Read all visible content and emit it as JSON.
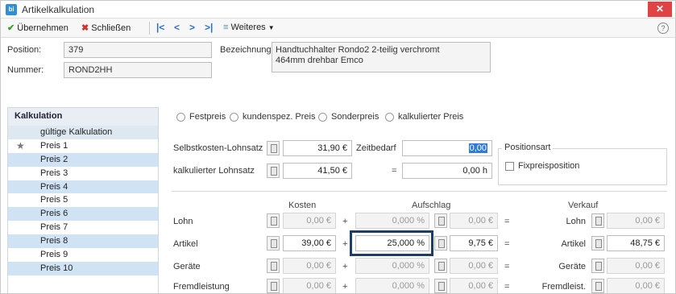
{
  "window": {
    "title": "Artikelkalkulation",
    "icon_text": "bi",
    "close_glyph": "✕"
  },
  "toolbar": {
    "apply_label": "Übernehmen",
    "close_label": "Schließen",
    "first_glyph": "|<",
    "prev_glyph": "<",
    "next_glyph": ">",
    "last_glyph": ">|",
    "more_label": "Weiteres",
    "help_glyph": "?"
  },
  "header": {
    "position_label": "Position:",
    "position_value": "379",
    "nummer_label": "Nummer:",
    "nummer_value": "ROND2HH",
    "bezeichnung_label": "Bezeichnung:",
    "bezeichnung_line1": "Handtuchhalter Rondo2 2-teilig verchromt",
    "bezeichnung_line2": "464mm drehbar Emco"
  },
  "kalkulation": {
    "title": "Kalkulation",
    "items": [
      {
        "label": "gültige Kalkulation"
      },
      {
        "label": "Preis 1"
      },
      {
        "label": "Preis 2"
      },
      {
        "label": "Preis 3"
      },
      {
        "label": "Preis 4"
      },
      {
        "label": "Preis 5"
      },
      {
        "label": "Preis 6"
      },
      {
        "label": "Preis 7"
      },
      {
        "label": "Preis 8"
      },
      {
        "label": "Preis 9"
      },
      {
        "label": "Preis 10"
      }
    ]
  },
  "price_type": {
    "options": [
      "Festpreis",
      "kundenspez. Preis",
      "Sonderpreis",
      "kalkulierter Preis"
    ]
  },
  "rates": {
    "selbstkosten_label": "Selbstkosten-Lohnsatz",
    "selbstkosten_value": "31,90 €",
    "zeitbedarf_label": "Zeitbedarf",
    "zeitbedarf_value": "0,00",
    "kalk_lohnsatz_label": "kalkulierter Lohnsatz",
    "kalk_lohnsatz_value": "41,50 €",
    "equals": "=",
    "result_value": "0,00 h"
  },
  "positionsart": {
    "title": "Positionsart",
    "fixpreis_label": "Fixpreisposition"
  },
  "table": {
    "headers": {
      "kosten": "Kosten",
      "aufschlag": "Aufschlag",
      "verkauf": "Verkauf"
    },
    "rows": [
      {
        "label": "Lohn",
        "kosten": "0,00 €",
        "pct": "0,000 %",
        "aufschlag": "0,00 €",
        "verkauf_label": "Lohn",
        "verkauf": "0,00 €"
      },
      {
        "label": "Artikel",
        "kosten": "39,00 €",
        "pct": "25,000 %",
        "aufschlag": "9,75 €",
        "verkauf_label": "Artikel",
        "verkauf": "48,75 €"
      },
      {
        "label": "Geräte",
        "kosten": "0,00 €",
        "pct": "0,000 %",
        "aufschlag": "0,00 €",
        "verkauf_label": "Geräte",
        "verkauf": "0,00 €"
      },
      {
        "label": "Fremdleistung",
        "kosten": "0,00 €",
        "pct": "0,000 %",
        "aufschlag": "0,00 €",
        "verkauf_label": "Fremdleist.",
        "verkauf": "0,00 €"
      }
    ],
    "plus": "+",
    "equals": "="
  }
}
